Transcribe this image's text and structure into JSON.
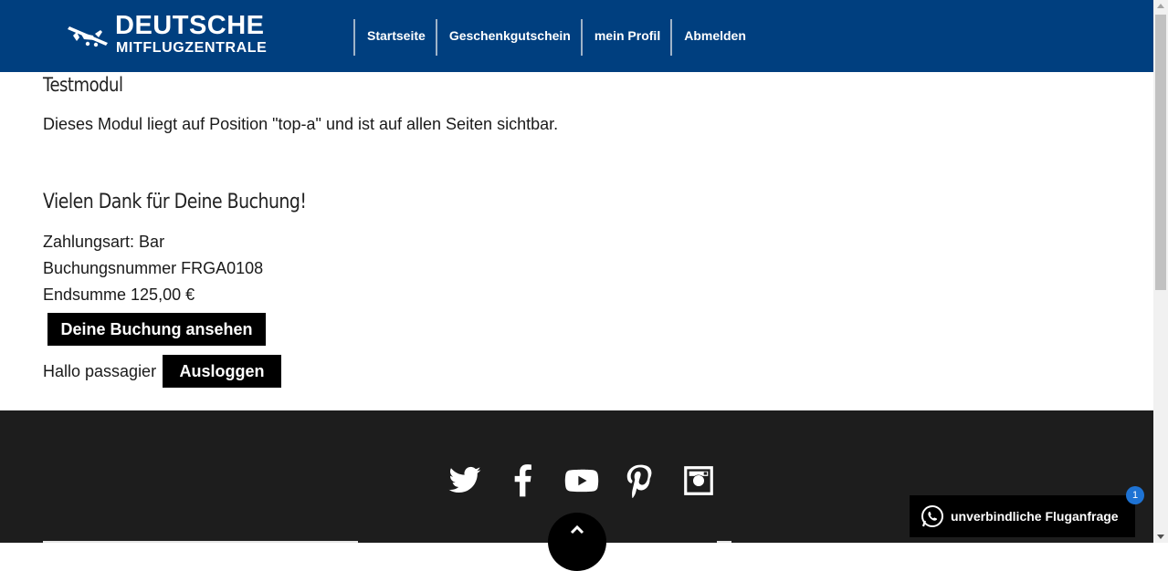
{
  "header": {
    "logo_line1": "DEUTSCHE",
    "logo_line2": "MITFLUGZENTRALE",
    "nav": [
      {
        "label": "Startseite"
      },
      {
        "label": "Geschenkgutschein"
      },
      {
        "label": "mein Profil"
      },
      {
        "label": "Abmelden"
      }
    ],
    "bg_color": "#003f7f"
  },
  "module": {
    "title": "Testmodul",
    "text": "Dieses Modul liegt auf Position \"top-a\" und ist auf allen Seiten sichtbar."
  },
  "booking": {
    "title": "Vielen Dank für Deine Buchung!",
    "payment": "Zahlungsart: Bar",
    "number": "Buchungsnummer FRGA0108",
    "total": "Endsumme 125,00 €",
    "view_button": "Deine Buchung ansehen"
  },
  "user": {
    "greeting": "Hallo passagier",
    "logout_button": "Ausloggen"
  },
  "footer": {
    "social": [
      "twitter-icon",
      "facebook-icon",
      "youtube-icon",
      "pinterest-icon",
      "instagram-icon"
    ],
    "bg_color": "#1d1d1d"
  },
  "whatsapp": {
    "label": "unverbindliche Fluganfrage",
    "badge": "1"
  }
}
